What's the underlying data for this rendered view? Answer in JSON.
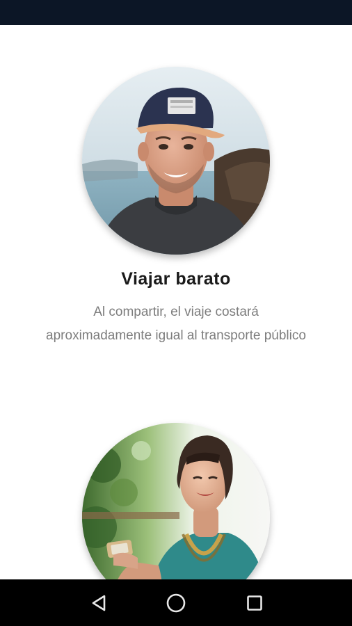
{
  "slide": {
    "title": "Viajar barato",
    "description": "Al compartir, el viaje costará aproximadamente igual al transporte público"
  },
  "colors": {
    "status_bar": "#0c1626",
    "nav_bar": "#000000",
    "title_text": "#1a1a1a",
    "description_text": "#7d7d7d"
  },
  "icons": {
    "nav_back": "back-triangle-icon",
    "nav_home": "home-circle-icon",
    "nav_recents": "recents-square-icon"
  }
}
